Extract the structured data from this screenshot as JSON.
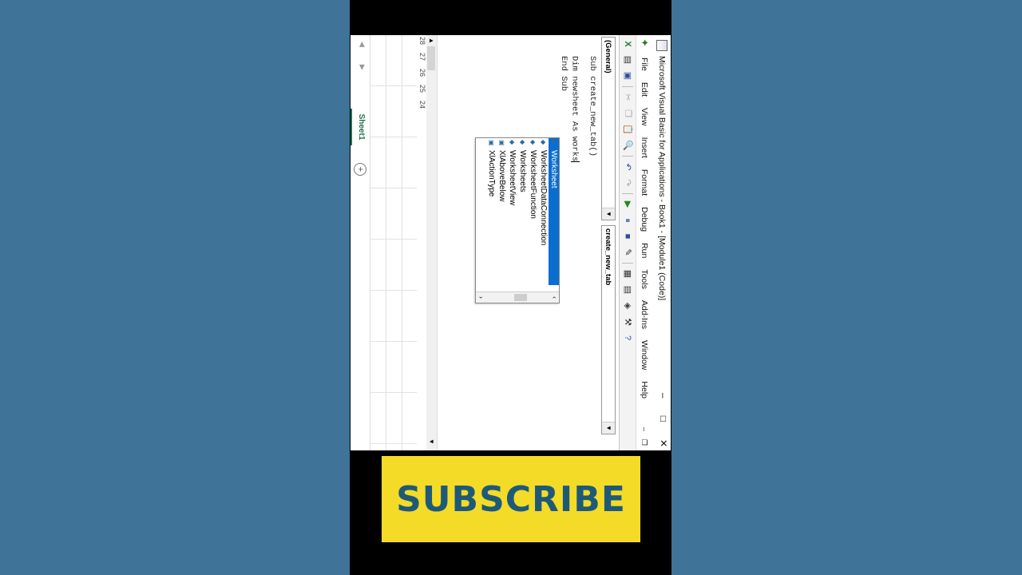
{
  "window": {
    "title": "Microsoft Visual Basic for Applications - Book1 - [Module1 (Code)]",
    "minimize": "–",
    "maximize": "□",
    "close": "✕"
  },
  "menu": {
    "items": [
      "File",
      "Edit",
      "View",
      "Insert",
      "Format",
      "Debug",
      "Run",
      "Tools",
      "Add-Ins",
      "Window",
      "Help"
    ],
    "mdi_min": "–",
    "mdi_restore": "❐"
  },
  "toolbar": {
    "icons": [
      "excel-icon",
      "insert-userform-icon",
      "save-icon",
      "cut-icon",
      "copy-icon",
      "paste-icon",
      "find-icon",
      "undo-icon",
      "redo-icon",
      "run-icon",
      "break-icon",
      "reset-icon",
      "design-mode-icon",
      "project-explorer-icon",
      "properties-icon",
      "object-browser-icon",
      "toolbox-icon",
      "help-icon"
    ]
  },
  "combos": {
    "object": "(General)",
    "procedure": "create_new_tab"
  },
  "code": {
    "line1": "Sub create_new_tab()",
    "line2": "Dim newsheet As works",
    "line3": "End Sub"
  },
  "intellisense": {
    "items": [
      "Worksheet",
      "WorksheetDataConnection",
      "WorksheetFunction",
      "Worksheets",
      "WorksheetView",
      "XlAboveBelow",
      "XlActionType"
    ],
    "selected_index": 0
  },
  "sheet": {
    "tab_name": "Sheet1",
    "rows": [
      "28",
      "27",
      "26",
      "25",
      "24"
    ]
  },
  "banner": {
    "text": "SUBSCRIBE",
    "color": "#f3db28",
    "text_color": "#1e5a78"
  }
}
